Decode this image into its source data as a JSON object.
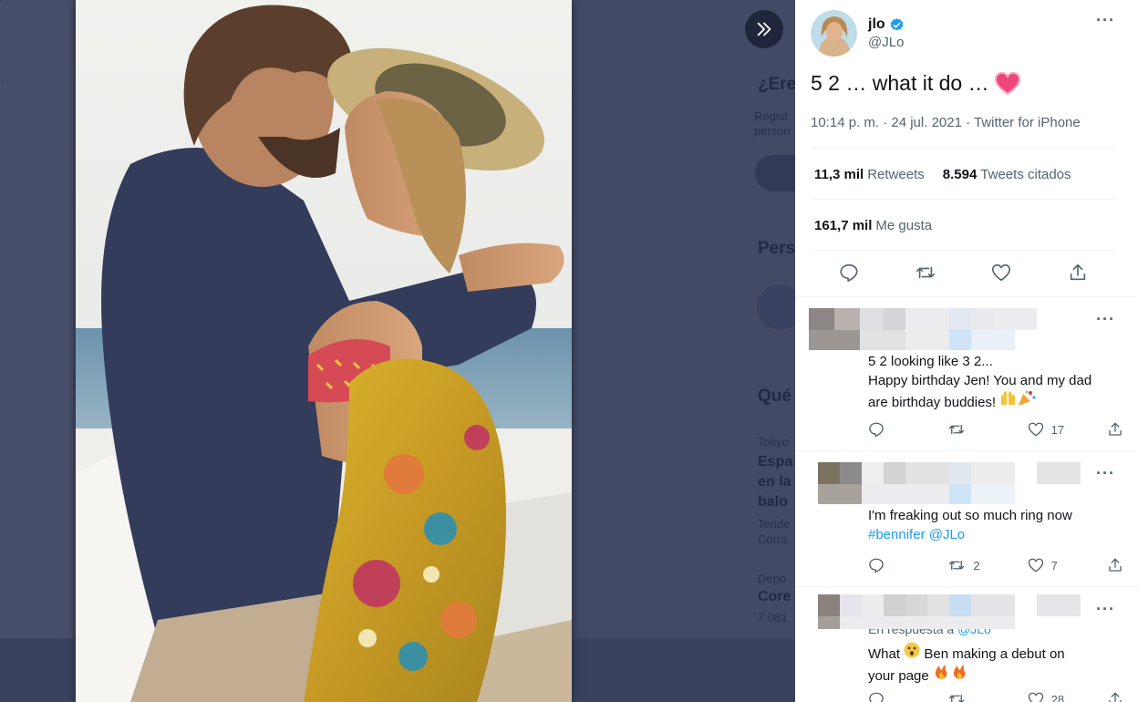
{
  "backdrop": {
    "texts": [
      "¿Ere",
      "Pers",
      "Qué",
      "Espa",
      "en la",
      "balo",
      "Core"
    ],
    "small_texts": [
      "Regist",
      "person",
      "Tokyo",
      "Tende",
      "Corra",
      "Depo",
      "7.081"
    ]
  },
  "tweet": {
    "display_name": "jlo",
    "handle": "@JLo",
    "text": "5  2 … what it do …",
    "timestamp": "10:14 p. m. · 24 jul. 2021 · Twitter for iPhone",
    "retweets_count": "11,3 mil",
    "retweets_label": "Retweets",
    "quotes_count": "8.594",
    "quotes_label": "Tweets citados",
    "likes_count": "161,7 mil",
    "likes_label": "Me gusta",
    "more": "···"
  },
  "replies": [
    {
      "line1": "5 2 looking like 3 2...",
      "line2": "Happy birthday Jen! You and my dad",
      "line3": "are birthday buddies!",
      "retweets": "",
      "likes": "17"
    },
    {
      "line1": "I'm freaking out so much ring now",
      "hashtag": "#bennifer",
      "mention": "@JLo",
      "retweets": "2",
      "likes": "7"
    },
    {
      "context_prefix": "En respuesta a",
      "context_mention": "@JLo",
      "line1a": "What",
      "line1b": "Ben making a debut on",
      "line2": "your page",
      "retweets": "",
      "likes": "28"
    }
  ],
  "colors": {
    "accent": "#1d9bf0",
    "text": "#0f1419",
    "muted": "#536471",
    "backdrop": "#424a66"
  },
  "icons": [
    "chevrons-right-icon",
    "verified-badge-icon",
    "reply-icon",
    "retweet-icon",
    "like-icon",
    "share-icon",
    "more-icon",
    "heart-emoji-icon",
    "raised-hands-emoji-icon",
    "party-popper-emoji-icon",
    "astonished-emoji-icon",
    "fire-emoji-icon"
  ]
}
